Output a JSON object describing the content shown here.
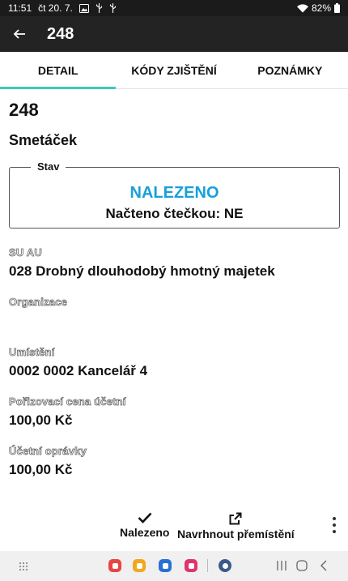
{
  "status_bar": {
    "time": "11:51",
    "date": "čt 20. 7.",
    "battery": "82%"
  },
  "app_bar": {
    "title": "248"
  },
  "tabs": [
    {
      "label": "DETAIL",
      "active": true
    },
    {
      "label": "KÓDY ZJIŠTĚNÍ",
      "active": false
    },
    {
      "label": "POZNÁMKY",
      "active": false
    }
  ],
  "detail": {
    "code": "248",
    "name": "Smetáček",
    "state": {
      "legend": "Stav",
      "status": "NALEZENO",
      "scanner": "Načteno čtečkou: NE"
    },
    "fields": [
      {
        "label": "SU AU",
        "value": "028 Drobný dlouhodobý hmotný majetek"
      },
      {
        "label": "Organizace",
        "value": ""
      },
      {
        "label": "Umístění",
        "value": "0002 0002 Kancelář 4"
      },
      {
        "label": "Pořizovací cena účetní",
        "value": "100,00 Kč"
      },
      {
        "label": "Účetní oprávky",
        "value": "100,00 Kč"
      }
    ]
  },
  "actions": {
    "found_label": "Nalezeno",
    "move_label": "Navrhnout přemístění"
  },
  "colors": {
    "accent": "#3ccab8",
    "status": "#18a0d8",
    "appbar": "#232323"
  }
}
